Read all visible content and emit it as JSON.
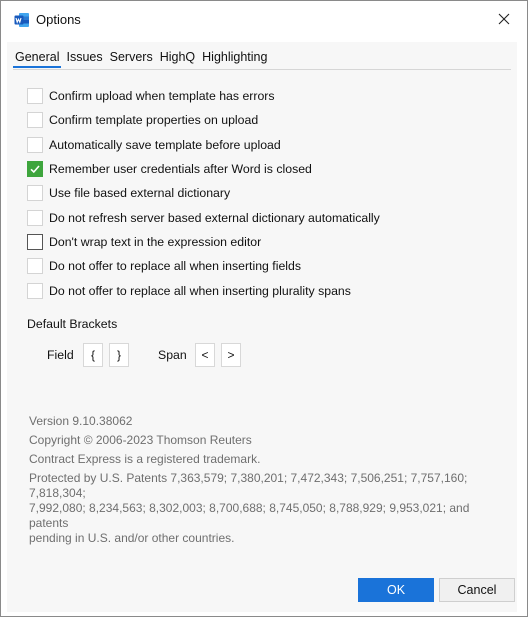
{
  "window": {
    "title": "Options",
    "app_icon": "word-icon",
    "close_icon": "close-icon"
  },
  "tabs": [
    {
      "label": "General",
      "active": true
    },
    {
      "label": "Issues",
      "active": false
    },
    {
      "label": "Servers",
      "active": false
    },
    {
      "label": "HighQ",
      "active": false
    },
    {
      "label": "Highlighting",
      "active": false
    }
  ],
  "options": [
    {
      "label": "Confirm upload when template has errors",
      "checked": false
    },
    {
      "label": "Confirm template properties on upload",
      "checked": false
    },
    {
      "label": "Automatically save template before upload",
      "checked": false
    },
    {
      "label": "Remember user credentials after Word is closed",
      "checked": true
    },
    {
      "label": "Use file based external dictionary",
      "checked": false
    },
    {
      "label": "Do not refresh server based external dictionary automatically",
      "checked": false
    },
    {
      "label": "Don't wrap text in the expression editor",
      "checked": false
    },
    {
      "label": "Do not offer to replace all when inserting fields",
      "checked": false
    },
    {
      "label": "Do not offer to replace all when inserting plurality spans",
      "checked": false
    }
  ],
  "brackets": {
    "section_label": "Default Brackets",
    "field_label": "Field",
    "field_open": "{",
    "field_close": "}",
    "span_label": "Span",
    "span_open": "<",
    "span_close": ">"
  },
  "info": {
    "version": "Version 9.10.38062",
    "copyright": "Copyright © 2006-2023 Thomson Reuters",
    "trademark": "Contract Express is a registered trademark.",
    "patents_line1": "Protected by U.S. Patents 7,363,579; 7,380,201; 7,472,343; 7,506,251; 7,757,160; 7,818,304;",
    "patents_line2": "7,992,080; 8,234,563; 8,302,003; 8,700,688; 8,745,050; 8,788,929; 9,953,021; and patents",
    "patents_line3": "pending in U.S. and/or other countries."
  },
  "buttons": {
    "ok": "OK",
    "cancel": "Cancel"
  },
  "colors": {
    "accent": "#1a73d9",
    "checked": "#3ea53d",
    "word_brand": "#185abd"
  }
}
